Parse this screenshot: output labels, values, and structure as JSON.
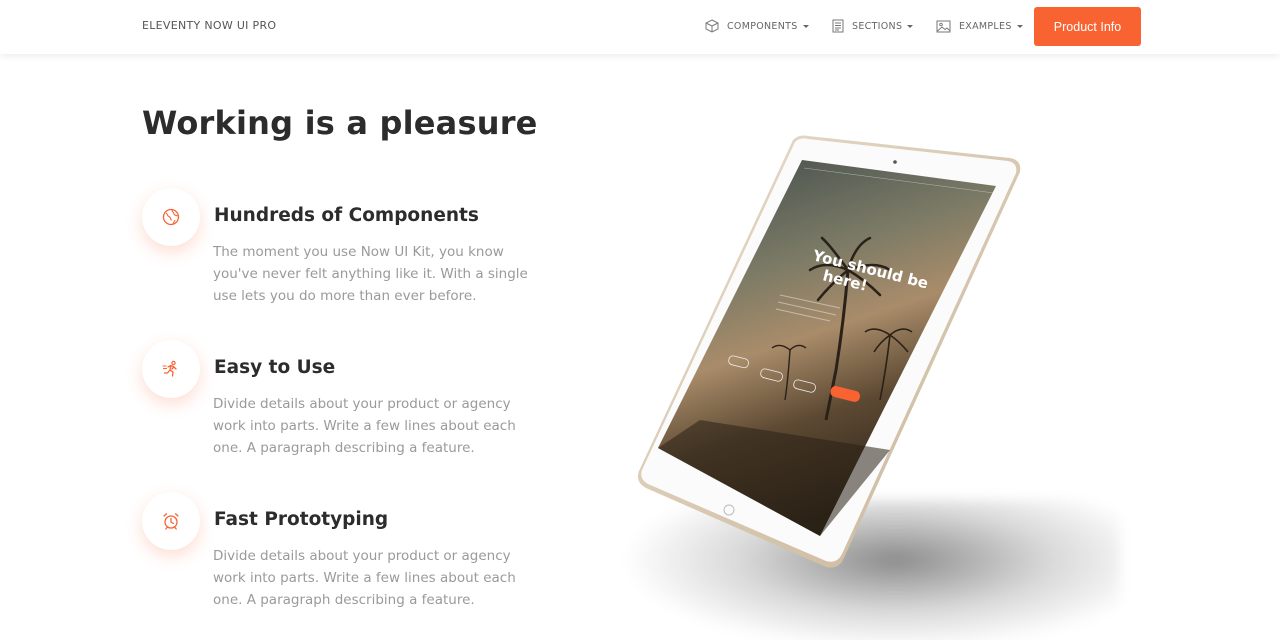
{
  "navbar": {
    "brand": "ELEVENTY NOW UI PRO",
    "items": [
      {
        "label": "COMPONENTS",
        "icon": "cube-icon"
      },
      {
        "label": "SECTIONS",
        "icon": "document-icon"
      },
      {
        "label": "EXAMPLES",
        "icon": "image-icon"
      }
    ],
    "cta": "Product Info"
  },
  "main": {
    "title": "Working is a pleasure",
    "features": [
      {
        "icon": "globe-icon",
        "title": "Hundreds of Components",
        "description": "The moment you use Now UI Kit, you know you've never felt anything like it. With a single use lets you do more than ever before."
      },
      {
        "icon": "running-person-icon",
        "title": "Easy to Use",
        "description": "Divide details about your product or agency work into parts. Write a few lines about each one. A paragraph describing a feature."
      },
      {
        "icon": "alarm-clock-icon",
        "title": "Fast Prototyping",
        "description": "Divide details about your product or agency work into parts. Write a few lines about each one. A paragraph describing a feature."
      }
    ]
  },
  "tablet": {
    "headline": "You should be here!"
  },
  "colors": {
    "accent": "#f96332",
    "text_dark": "#2c2c2c",
    "text_muted": "#9a9a9a"
  }
}
